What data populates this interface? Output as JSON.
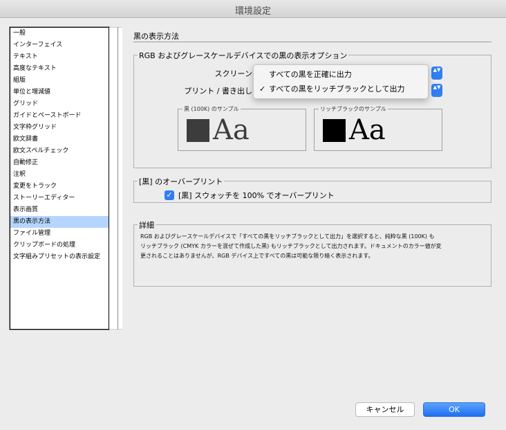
{
  "window": {
    "title": "環境設定"
  },
  "sidebar": {
    "selected_index": 16,
    "items": [
      "一般",
      "インターフェイス",
      "テキスト",
      "高度なテキスト",
      "組版",
      "単位と増減値",
      "グリッド",
      "ガイドとペーストボード",
      "文字枠グリッド",
      "欧文辞書",
      "欧文スペルチェック",
      "自動修正",
      "注釈",
      "変更をトラック",
      "ストーリーエディター",
      "表示画質",
      "黒の表示方法",
      "ファイル管理",
      "クリップボードの処理",
      "文字組みプリセットの表示設定"
    ]
  },
  "page": {
    "title": "黒の表示方法"
  },
  "rgb_group": {
    "legend": "RGB およびグレースケールデバイスでの黒の表示オプション",
    "screen_label": "スクリーン",
    "print_label": "プリント / 書き出し",
    "dropdown_options": [
      {
        "label": "すべての黒を正確に出力",
        "checked": false
      },
      {
        "label": "すべての黒をリッチブラックとして出力",
        "checked": true
      }
    ],
    "check_glyph": "✓",
    "stepper_glyph": "▲▼",
    "sample_100k": {
      "label": "黒 (100K) のサンプル",
      "text": "Aa",
      "color": "#3c3c3c"
    },
    "sample_rich": {
      "label": "リッチブラックのサンプル",
      "text": "Aa",
      "color": "#000000"
    }
  },
  "overprint_group": {
    "legend": "[黒] のオーバープリント",
    "checkbox_label": "[黒] スウォッチを 100% でオーバープリント",
    "checked": true,
    "check_glyph": "✓"
  },
  "details_group": {
    "legend": "詳細",
    "lines": [
      "RGB およびグレースケールデバイスで「すべての黒をリッチブラックとして出力」を選択すると、純粋な黒 (100K) も",
      "リッチブラック (CMYK カラーを混ぜて作成した黒) もリッチブラックとして出力されます。ドキュメントのカラー値が変",
      "更されることはありませんが、RGB デバイス上ですべての黒は可能な限り暗く表示されます。"
    ]
  },
  "buttons": {
    "cancel": "キャンセル",
    "ok": "OK"
  },
  "colors": {
    "accent": "#2f7ff3",
    "selection": "#b5d5ff"
  }
}
